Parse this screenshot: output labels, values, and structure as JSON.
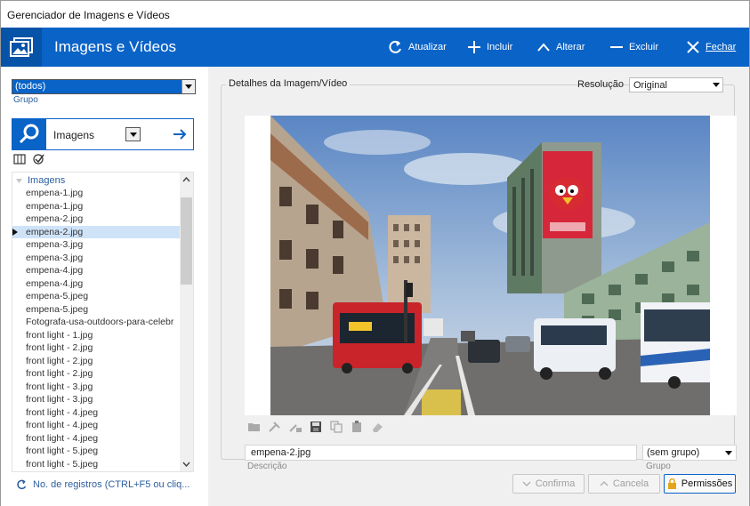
{
  "window": {
    "title": "Gerenciador de Imagens e Vídeos"
  },
  "header": {
    "title": "Imagens e Vídeos",
    "buttons": {
      "refresh": "Atualizar",
      "add": "Incluir",
      "edit": "Alterar",
      "delete": "Excluir",
      "close": "Fechar"
    }
  },
  "left": {
    "group_combo": {
      "value": "(todos)",
      "label": "Grupo"
    },
    "search": {
      "type_value": "Imagens"
    },
    "list": {
      "header": "Imagens",
      "items": [
        "empena-1.jpg",
        "empena-1.jpg",
        "empena-2.jpg",
        "empena-2.jpg",
        "empena-3.jpg",
        "empena-3.jpg",
        "empena-4.jpg",
        "empena-4.jpg",
        "empena-5.jpeg",
        "empena-5.jpeg",
        "Fotografa-usa-outdoors-para-celebr",
        "front light - 1.jpg",
        "front light - 2.jpg",
        "front light - 2.jpg",
        "front light - 2.jpg",
        "front light - 3.jpg",
        "front light - 3.jpg",
        "front light - 4.jpeg",
        "front light - 4.jpeg",
        "front light - 4.jpeg",
        "front light - 5.jpeg",
        "front light - 5.jpeg"
      ],
      "selected_index": 3
    },
    "records_text": "No. de registros (CTRL+F5 ou cliq..."
  },
  "details": {
    "title": "Detalhes da Imagem/Vídeo",
    "resolution_label": "Resolução",
    "resolution_value": "Original",
    "description_value": "empena-2.jpg",
    "description_label": "Descrição",
    "group_value": "(sem grupo)",
    "group_label": "Grupo"
  },
  "footer": {
    "confirm": "Confirma",
    "cancel": "Cancela",
    "permissions": "Permissões"
  },
  "colors": {
    "accent": "#0a63c7",
    "selected_row": "#cfe3f8"
  }
}
